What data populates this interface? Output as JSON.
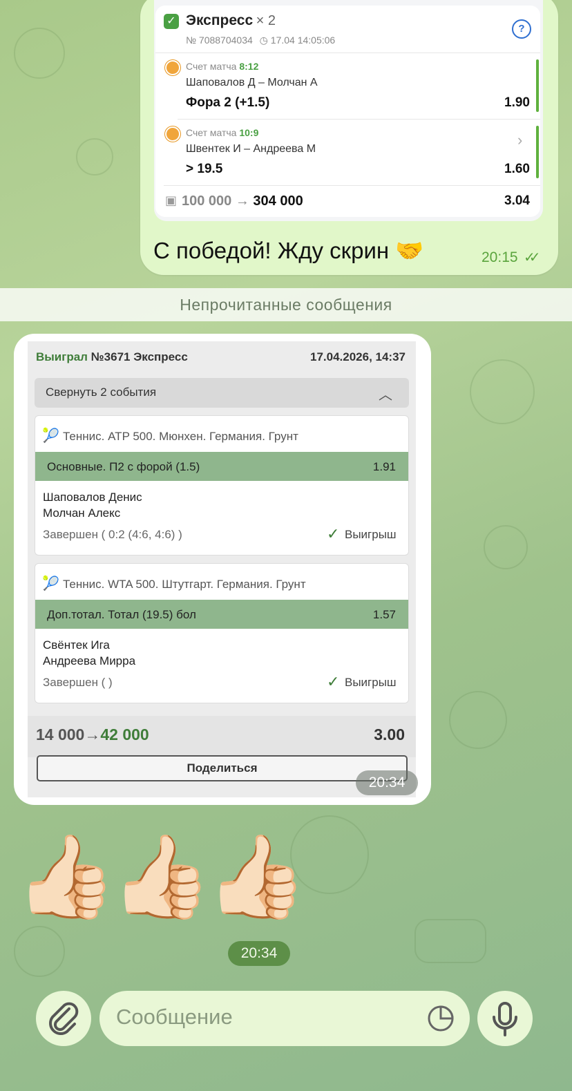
{
  "outgoing_message": {
    "screenshot": {
      "title": "Экспресс",
      "multiplier": "× 2",
      "bet_number": "№ 7088704034",
      "datetime": "17.04 14:05:06",
      "events": [
        {
          "score_label": "Счет матча",
          "score": "8:12",
          "teams": "Шаповалов Д – Молчан А",
          "bet": "Фора 2 (+1.5)",
          "odd": "1.90"
        },
        {
          "score_label": "Счет матча",
          "score": "10:9",
          "teams": "Швентек И – Андреева М",
          "bet": "> 19.5",
          "odd": "1.60"
        }
      ],
      "stake": "100 000",
      "arrow": "→",
      "payout": "304 000",
      "total_odd": "3.04"
    },
    "text": "С победой! Жду скрин 🤝",
    "time": "20:15"
  },
  "unread_divider": "Непрочитанные сообщения",
  "incoming_receipt": {
    "status": "Выиграл",
    "title": "№3671 Экспресс",
    "datetime": "17.04.2026, 14:37",
    "collapse_label": "Свернуть 2 события",
    "events": [
      {
        "tournament": "Теннис. ATP 500. Мюнхен. Германия. Грунт",
        "market": "Основные. П2 с форой (1.5)",
        "odd": "1.91",
        "player1": "Шаповалов Денис",
        "player2": "Молчан Алекс",
        "status": "Завершен ( 0:2 (4:6, 4:6) )",
        "result": "Выигрыш"
      },
      {
        "tournament": "Теннис. WTA 500. Штутгарт. Германия. Грунт",
        "market": "Доп.тотал. Тотал (19.5) бол",
        "odd": "1.57",
        "player1": "Свёнтек Ига",
        "player2": "Андреева Мирра",
        "status": "Завершен ( )",
        "result": "Выигрыш"
      }
    ],
    "stake": "14 000",
    "arrow": "→",
    "payout": "42 000",
    "total_odd": "3.00",
    "share_label": "Поделиться",
    "time": "20:34"
  },
  "emoji_message": {
    "emojis": [
      "👍🏻",
      "👍🏻",
      "👍🏻"
    ],
    "time": "20:34"
  },
  "input_bar": {
    "placeholder": "Сообщение"
  },
  "colors": {
    "chat_bg": "#a9c98a",
    "outgoing_bubble": "#e1f7c9",
    "accent_green": "#4aa043",
    "market_bar": "#8fb68d"
  }
}
